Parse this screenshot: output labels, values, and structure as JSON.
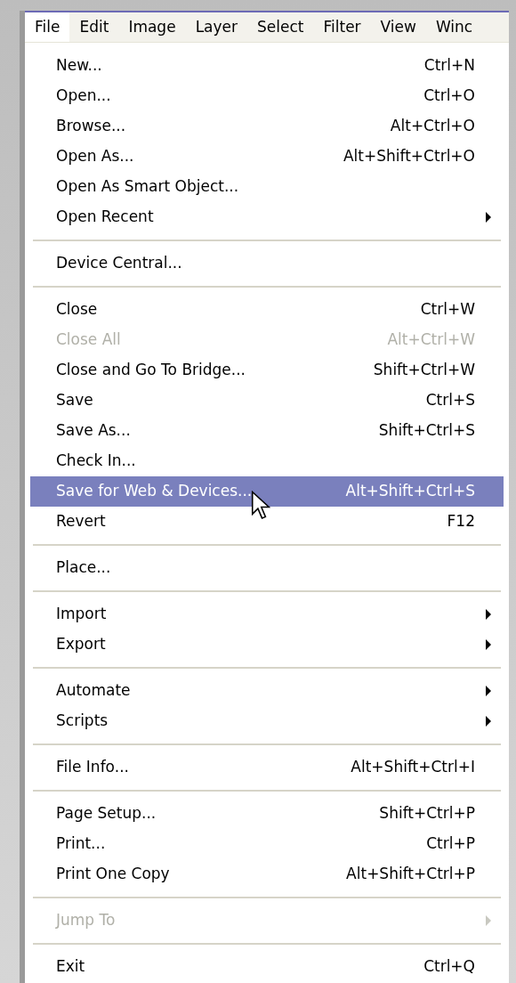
{
  "menu_bar": [
    {
      "label": "File",
      "selected": true
    },
    {
      "label": "Edit",
      "selected": false
    },
    {
      "label": "Image",
      "selected": false
    },
    {
      "label": "Layer",
      "selected": false
    },
    {
      "label": "Select",
      "selected": false
    },
    {
      "label": "Filter",
      "selected": false
    },
    {
      "label": "View",
      "selected": false
    },
    {
      "label": "Winc",
      "selected": false
    }
  ],
  "menu_groups": [
    [
      {
        "kind": "command",
        "label": "New...",
        "shortcut": "Ctrl+N",
        "disabled": false,
        "selected": false
      },
      {
        "kind": "command",
        "label": "Open...",
        "shortcut": "Ctrl+O",
        "disabled": false,
        "selected": false
      },
      {
        "kind": "command",
        "label": "Browse...",
        "shortcut": "Alt+Ctrl+O",
        "disabled": false,
        "selected": false
      },
      {
        "kind": "command",
        "label": "Open As...",
        "shortcut": "Alt+Shift+Ctrl+O",
        "disabled": false,
        "selected": false
      },
      {
        "kind": "command",
        "label": "Open As Smart Object...",
        "disabled": false,
        "selected": false
      },
      {
        "kind": "submenu",
        "label": "Open Recent",
        "disabled": false,
        "selected": false
      }
    ],
    [
      {
        "kind": "command",
        "label": "Device Central...",
        "disabled": false,
        "selected": false
      }
    ],
    [
      {
        "kind": "command",
        "label": "Close",
        "shortcut": "Ctrl+W",
        "disabled": false,
        "selected": false
      },
      {
        "kind": "command",
        "label": "Close All",
        "shortcut": "Alt+Ctrl+W",
        "disabled": true,
        "selected": false
      },
      {
        "kind": "command",
        "label": "Close and Go To Bridge...",
        "shortcut": "Shift+Ctrl+W",
        "disabled": false,
        "selected": false
      },
      {
        "kind": "command",
        "label": "Save",
        "shortcut": "Ctrl+S",
        "disabled": false,
        "selected": false
      },
      {
        "kind": "command",
        "label": "Save As...",
        "shortcut": "Shift+Ctrl+S",
        "disabled": false,
        "selected": false
      },
      {
        "kind": "command",
        "label": "Check In...",
        "disabled": false,
        "selected": false
      },
      {
        "kind": "command",
        "label": "Save for Web & Devices...",
        "shortcut": "Alt+Shift+Ctrl+S",
        "disabled": false,
        "selected": true
      },
      {
        "kind": "command",
        "label": "Revert",
        "shortcut": "F12",
        "disabled": false,
        "selected": false
      }
    ],
    [
      {
        "kind": "command",
        "label": "Place...",
        "disabled": false,
        "selected": false
      }
    ],
    [
      {
        "kind": "submenu",
        "label": "Import",
        "disabled": false,
        "selected": false
      },
      {
        "kind": "submenu",
        "label": "Export",
        "disabled": false,
        "selected": false
      }
    ],
    [
      {
        "kind": "submenu",
        "label": "Automate",
        "disabled": false,
        "selected": false
      },
      {
        "kind": "submenu",
        "label": "Scripts",
        "disabled": false,
        "selected": false
      }
    ],
    [
      {
        "kind": "command",
        "label": "File Info...",
        "shortcut": "Alt+Shift+Ctrl+I",
        "disabled": false,
        "selected": false
      }
    ],
    [
      {
        "kind": "command",
        "label": "Page Setup...",
        "shortcut": "Shift+Ctrl+P",
        "disabled": false,
        "selected": false
      },
      {
        "kind": "command",
        "label": "Print...",
        "shortcut": "Ctrl+P",
        "disabled": false,
        "selected": false
      },
      {
        "kind": "command",
        "label": "Print One Copy",
        "shortcut": "Alt+Shift+Ctrl+P",
        "disabled": false,
        "selected": false
      }
    ],
    [
      {
        "kind": "submenu",
        "label": "Jump To",
        "disabled": true,
        "selected": false
      }
    ],
    [
      {
        "kind": "command",
        "label": "Exit",
        "shortcut": "Ctrl+Q",
        "disabled": false,
        "selected": false
      }
    ]
  ]
}
